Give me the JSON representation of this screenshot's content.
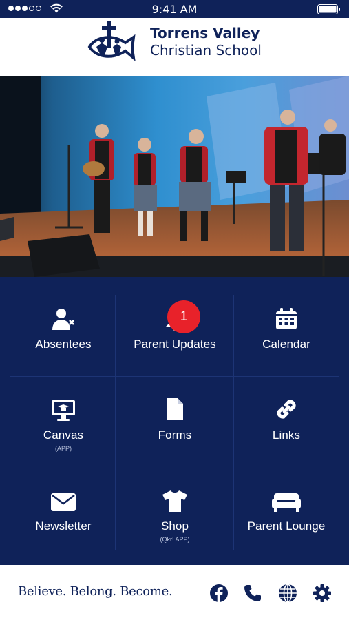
{
  "status_bar": {
    "time": "9:41 AM"
  },
  "header": {
    "school_name_line1": "Torrens Valley",
    "school_name_line2": "Christian School"
  },
  "hero": {
    "icon": "performance-photo"
  },
  "menu": {
    "absentees": {
      "label": "Absentees",
      "icon": "user-x-icon"
    },
    "parent_updates": {
      "label": "Parent Updates",
      "icon": "bell-icon",
      "badge": "1"
    },
    "calendar": {
      "label": "Calendar",
      "icon": "calendar-icon"
    },
    "canvas": {
      "label": "Canvas",
      "sub": "(APP)",
      "icon": "monitor-icon"
    },
    "forms": {
      "label": "Forms",
      "icon": "document-icon"
    },
    "links": {
      "label": "Links",
      "icon": "link-icon"
    },
    "newsletter": {
      "label": "Newsletter",
      "icon": "envelope-icon"
    },
    "shop": {
      "label": "Shop",
      "sub": "(Qkr! APP)",
      "icon": "tshirt-icon"
    },
    "parent_lounge": {
      "label": "Parent Lounge",
      "icon": "sofa-icon"
    }
  },
  "footer": {
    "motto": "Believe. Belong. Become.",
    "icons": [
      "facebook-icon",
      "phone-icon",
      "globe-icon",
      "gear-icon"
    ]
  },
  "colors": {
    "navy": "#0f2259",
    "badge_red": "#e8222a",
    "white": "#ffffff"
  }
}
